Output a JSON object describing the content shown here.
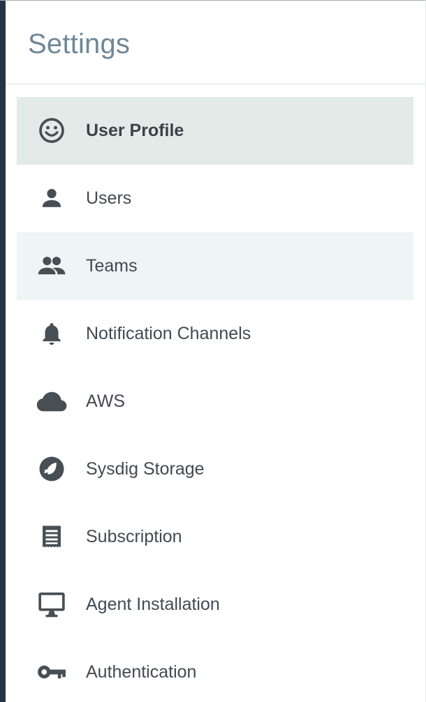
{
  "header": {
    "title": "Settings"
  },
  "menu": {
    "items": [
      {
        "label": "User Profile",
        "icon": "smiley-face-icon",
        "state": "selected"
      },
      {
        "label": "Users",
        "icon": "person-icon",
        "state": "default"
      },
      {
        "label": "Teams",
        "icon": "people-group-icon",
        "state": "hover"
      },
      {
        "label": "Notification Channels",
        "icon": "bell-icon",
        "state": "default"
      },
      {
        "label": "AWS",
        "icon": "cloud-icon",
        "state": "default"
      },
      {
        "label": "Sysdig Storage",
        "icon": "storage-logo-icon",
        "state": "default"
      },
      {
        "label": "Subscription",
        "icon": "receipt-icon",
        "state": "default"
      },
      {
        "label": "Agent Installation",
        "icon": "desktop-monitor-icon",
        "state": "default"
      },
      {
        "label": "Authentication",
        "icon": "key-icon",
        "state": "default"
      }
    ]
  },
  "colors": {
    "sidebar_rail": "#243447",
    "title": "#6f8797",
    "text": "#414a52",
    "icon": "#474f55",
    "selected_background": "#e3ebe9",
    "hover_background": "#eff4f5",
    "divider": "#dfe3e6"
  }
}
